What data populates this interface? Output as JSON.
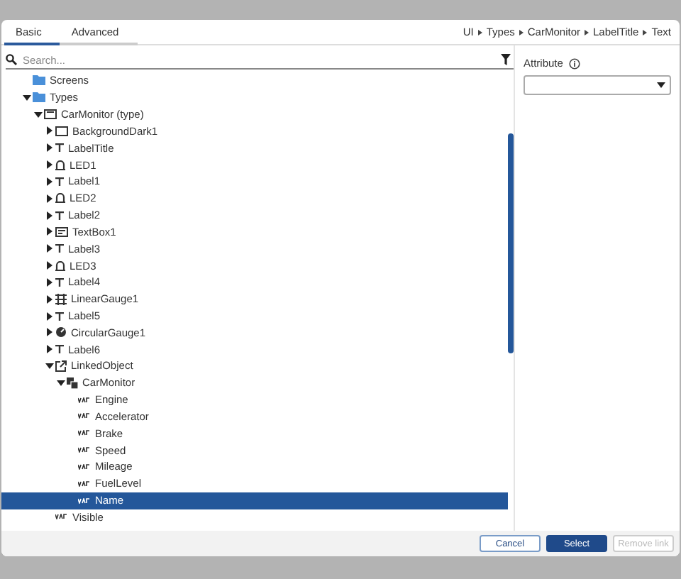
{
  "tabs": [
    {
      "label": "Basic",
      "selected": true
    },
    {
      "label": "Advanced",
      "selected": false
    }
  ],
  "breadcrumb": [
    "UI",
    "Types",
    "CarMonitor",
    "LabelTitle",
    "Text"
  ],
  "search": {
    "placeholder": "Search..."
  },
  "tree": [
    {
      "label": "Screens",
      "kind": "folder",
      "selected": false
    },
    {
      "label": "Types",
      "kind": "folder",
      "expanded": true,
      "selected": false,
      "children": [
        {
          "label": "CarMonitor (type)",
          "kind": "window",
          "expanded": true,
          "selected": false,
          "children": [
            {
              "label": "BackgroundDark1",
              "kind": "rect",
              "expanded": false,
              "selected": false
            },
            {
              "label": "LabelTitle",
              "kind": "text",
              "expanded": false,
              "selected": false
            },
            {
              "label": "LED1",
              "kind": "bell",
              "expanded": false,
              "selected": false
            },
            {
              "label": "Label1",
              "kind": "text",
              "expanded": false,
              "selected": false
            },
            {
              "label": "LED2",
              "kind": "bell",
              "expanded": false,
              "selected": false
            },
            {
              "label": "Label2",
              "kind": "text",
              "expanded": false,
              "selected": false
            },
            {
              "label": "TextBox1",
              "kind": "textbox",
              "expanded": false,
              "selected": false
            },
            {
              "label": "Label3",
              "kind": "text",
              "expanded": false,
              "selected": false
            },
            {
              "label": "LED3",
              "kind": "bell",
              "expanded": false,
              "selected": false
            },
            {
              "label": "Label4",
              "kind": "text",
              "expanded": false,
              "selected": false
            },
            {
              "label": "LinearGauge1",
              "kind": "lineargauge",
              "expanded": false,
              "selected": false
            },
            {
              "label": "Label5",
              "kind": "text",
              "expanded": false,
              "selected": false
            },
            {
              "label": "CircularGauge1",
              "kind": "circulargauge",
              "expanded": false,
              "selected": false
            },
            {
              "label": "Label6",
              "kind": "text",
              "expanded": false,
              "selected": false
            },
            {
              "label": "LinkedObject",
              "kind": "link",
              "expanded": true,
              "selected": false,
              "children": [
                {
                  "label": "CarMonitor",
                  "kind": "object",
                  "expanded": true,
                  "selected": false,
                  "children": [
                    {
                      "label": "Engine",
                      "kind": "var",
                      "selected": false
                    },
                    {
                      "label": "Accelerator",
                      "kind": "var",
                      "selected": false
                    },
                    {
                      "label": "Brake",
                      "kind": "var",
                      "selected": false
                    },
                    {
                      "label": "Speed",
                      "kind": "var",
                      "selected": false
                    },
                    {
                      "label": "Mileage",
                      "kind": "var",
                      "selected": false
                    },
                    {
                      "label": "FuelLevel",
                      "kind": "var",
                      "selected": false
                    },
                    {
                      "label": "Name",
                      "kind": "var",
                      "selected": true
                    }
                  ]
                }
              ]
            },
            {
              "label": "Visible",
              "kind": "var",
              "selected": false
            }
          ]
        }
      ]
    }
  ],
  "attribute": {
    "label": "Attribute"
  },
  "buttons": [
    {
      "label": "Cancel",
      "kind": "secondary",
      "disabled": false
    },
    {
      "label": "Select",
      "kind": "primary",
      "disabled": false
    },
    {
      "label": "Remove link",
      "kind": "secondary",
      "disabled": true
    }
  ]
}
